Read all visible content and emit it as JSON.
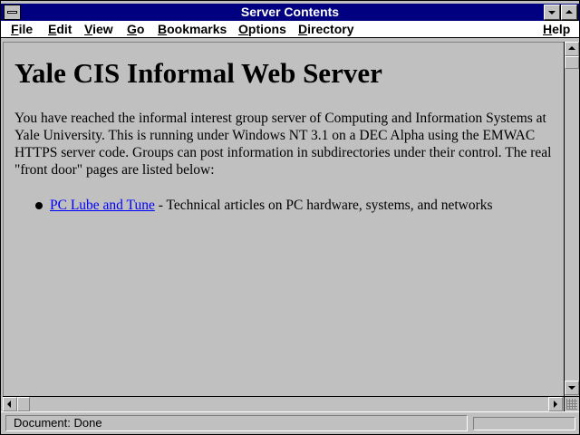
{
  "window": {
    "title": "Server Contents"
  },
  "menu": {
    "items": [
      "File",
      "Edit",
      "View",
      "Go",
      "Bookmarks",
      "Options",
      "Directory"
    ],
    "help": "Help"
  },
  "page": {
    "heading": "Yale CIS Informal Web Server",
    "intro": "You have reached the informal interest group server of Computing and Information Systems at Yale University. This is running under Windows NT 3.1 on a DEC Alpha using the EMWAC HTTPS server code. Groups can post information in subdirectories under their control. The real \"front door\" pages are listed below:",
    "links": [
      {
        "link_text": "PC Lube and Tune",
        "description": " - Technical articles on PC hardware, systems, and networks"
      }
    ]
  },
  "status": {
    "text": "Document: Done",
    "progress": 0
  },
  "colors": {
    "title_bar": "#000080",
    "window_bg": "#c0c0c0",
    "link": "#0000ff"
  },
  "icons": {
    "system_menu": "system-menu-icon",
    "minimize": "minimize-arrow-icon",
    "maximize": "maximize-arrow-icon",
    "scroll_up": "scroll-up-arrow-icon",
    "scroll_down": "scroll-down-arrow-icon",
    "scroll_left": "scroll-left-arrow-icon",
    "scroll_right": "scroll-right-arrow-icon",
    "bullet": "bullet-icon"
  }
}
